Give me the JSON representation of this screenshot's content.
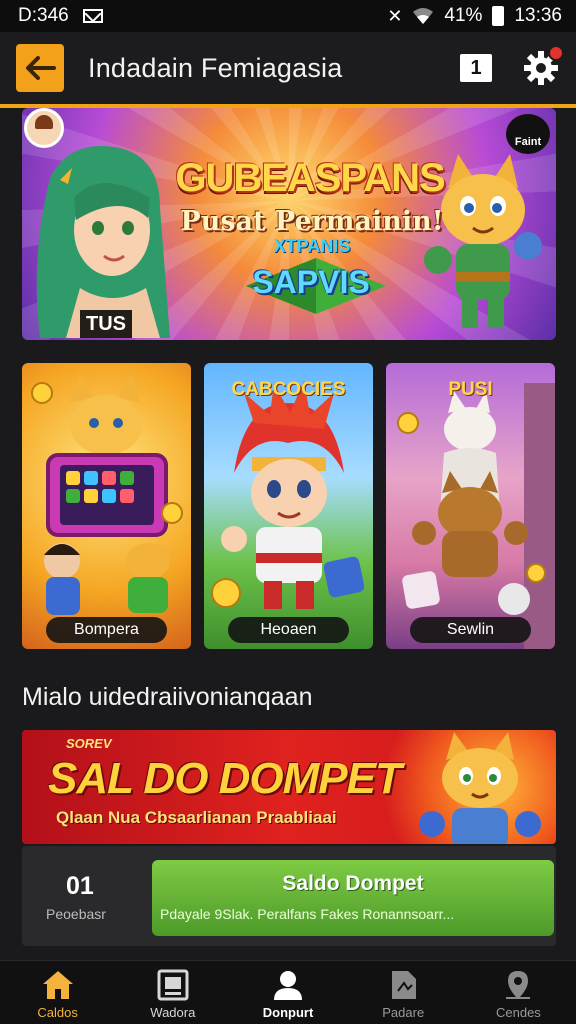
{
  "status_bar": {
    "time": "D:346",
    "battery": "41%",
    "clock": "13:36"
  },
  "header": {
    "title": "Indadain Femiagasia",
    "notification_count": "1"
  },
  "hero": {
    "title": "GUBEASPANS",
    "subtitle": "Pusat Permainin!",
    "small_text": "XTPANIS",
    "tag": "SAPVIS",
    "label": "TUS",
    "corner_text": "Faint"
  },
  "cards": [
    {
      "top_label": "",
      "label": "Bompera"
    },
    {
      "top_label": "CABCOCIES",
      "label": "Heoaen"
    },
    {
      "top_label": "PUSI",
      "label": "Sewlin"
    }
  ],
  "section_heading": "Mialo uidedraiivonianqaan",
  "promo": {
    "small": "SOREV",
    "title": "SAL DO DOMPET",
    "subtitle": "Qlaan Nua Cbsaarlianan Praabliaai"
  },
  "wallet": {
    "count": "01",
    "caption": "Peoebasr",
    "button_title": "Saldo Dompet",
    "button_sub": "Pdayale  9Slak.  Peralfans  Fakes Ronannsoarr..."
  },
  "nav": [
    {
      "label": "Caldos"
    },
    {
      "label": "Wadora"
    },
    {
      "label": "Donpurt"
    },
    {
      "label": "Padare"
    },
    {
      "label": "Cendes"
    }
  ],
  "colors": {
    "accent": "#f0a416",
    "green": "#5fae32",
    "promo_red": "#d81c1e",
    "background": "#1a1a1c"
  }
}
